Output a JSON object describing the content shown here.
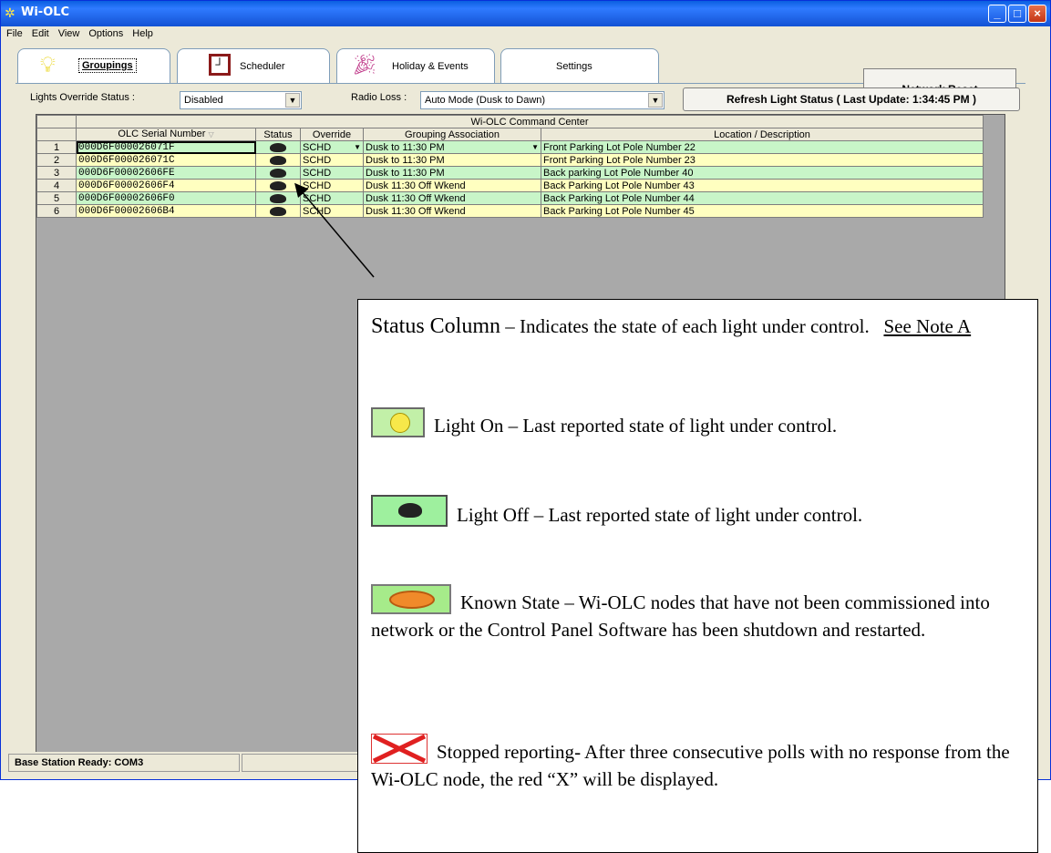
{
  "window": {
    "title": "Wi-OLC",
    "controls": {
      "minimize": "_",
      "maximize": "□",
      "close": "×"
    }
  },
  "menu": [
    "File",
    "Edit",
    "View",
    "Options",
    "Help"
  ],
  "tabs": [
    {
      "label": "Groupings",
      "icon": "lightbulb-icon",
      "active": true
    },
    {
      "label": "Scheduler",
      "icon": "clock-icon"
    },
    {
      "label": "Holiday & Events",
      "icon": "party-icon"
    },
    {
      "label": "Settings"
    }
  ],
  "network_reset_label": "Network Reset",
  "controls": {
    "lights_override_label": "Lights Override Status :",
    "lights_override_value": "Disabled",
    "radio_loss_label": "Radio Loss :",
    "radio_loss_value": "Auto Mode (Dusk to Dawn)",
    "refresh_label": "Refresh Light Status ( Last Update: 1:34:45 PM )"
  },
  "grid": {
    "title": "Wi-OLC Command Center",
    "columns": [
      "OLC Serial Number",
      "Status",
      "Override",
      "Grouping Association",
      "Location / Description"
    ],
    "rows": [
      {
        "n": "1",
        "serial": "000D6F000026071F",
        "override": "SCHD",
        "grouping": "Dusk to 11:30 PM",
        "location": "Front Parking Lot Pole Number 22",
        "color": "green"
      },
      {
        "n": "2",
        "serial": "000D6F000026071C",
        "override": "SCHD",
        "grouping": "Dusk to 11:30 PM",
        "location": "Front Parking Lot Pole Number 23",
        "color": "yellow"
      },
      {
        "n": "3",
        "serial": "000D6F00002606FE",
        "override": "SCHD",
        "grouping": "Dusk to 11:30 PM",
        "location": "Back parking Lot Pole Number 40",
        "color": "green"
      },
      {
        "n": "4",
        "serial": "000D6F00002606F4",
        "override": "SCHD",
        "grouping": "Dusk 11:30 Off Wkend",
        "location": "Back Parking Lot Pole Number 43",
        "color": "yellow"
      },
      {
        "n": "5",
        "serial": "000D6F00002606F0",
        "override": "SCHD",
        "grouping": "Dusk 11:30 Off Wkend",
        "location": "Back Parking Lot Pole Number 44",
        "color": "green"
      },
      {
        "n": "6",
        "serial": "000D6F00002606B4",
        "override": "SCHD",
        "grouping": "Dusk 11:30 Off Wkend",
        "location": "Back Parking Lot Pole Number 45",
        "color": "yellow"
      }
    ]
  },
  "statusbar": {
    "text": "Base Station Ready: COM3"
  },
  "callout": {
    "heading_title": "Status Column",
    "heading_text": " – Indicates the state of each light under control.",
    "note_link": "See Note A",
    "items": [
      {
        "icon": "light-on-icon",
        "title": "Light On",
        "text": " – Last reported state of light under control."
      },
      {
        "icon": "light-off-icon",
        "title": "Light Off",
        "text": " – Last reported state of light under control."
      },
      {
        "icon": "known-state-icon",
        "title": "Known State",
        "text": " – Wi-OLC nodes that have not been commissioned into network or the Control Panel Software has been shutdown and restarted."
      },
      {
        "icon": "stopped-reporting-icon",
        "title": "Stopped reporting",
        "text": "- After three consecutive polls with no response from the Wi-OLC node, the red “X” will be displayed."
      }
    ]
  },
  "colors": {
    "row_green": "#c8f5c8",
    "row_yellow": "#ffffc0",
    "titlebar": "#1f63e6",
    "stopped_x": "#e02020"
  }
}
